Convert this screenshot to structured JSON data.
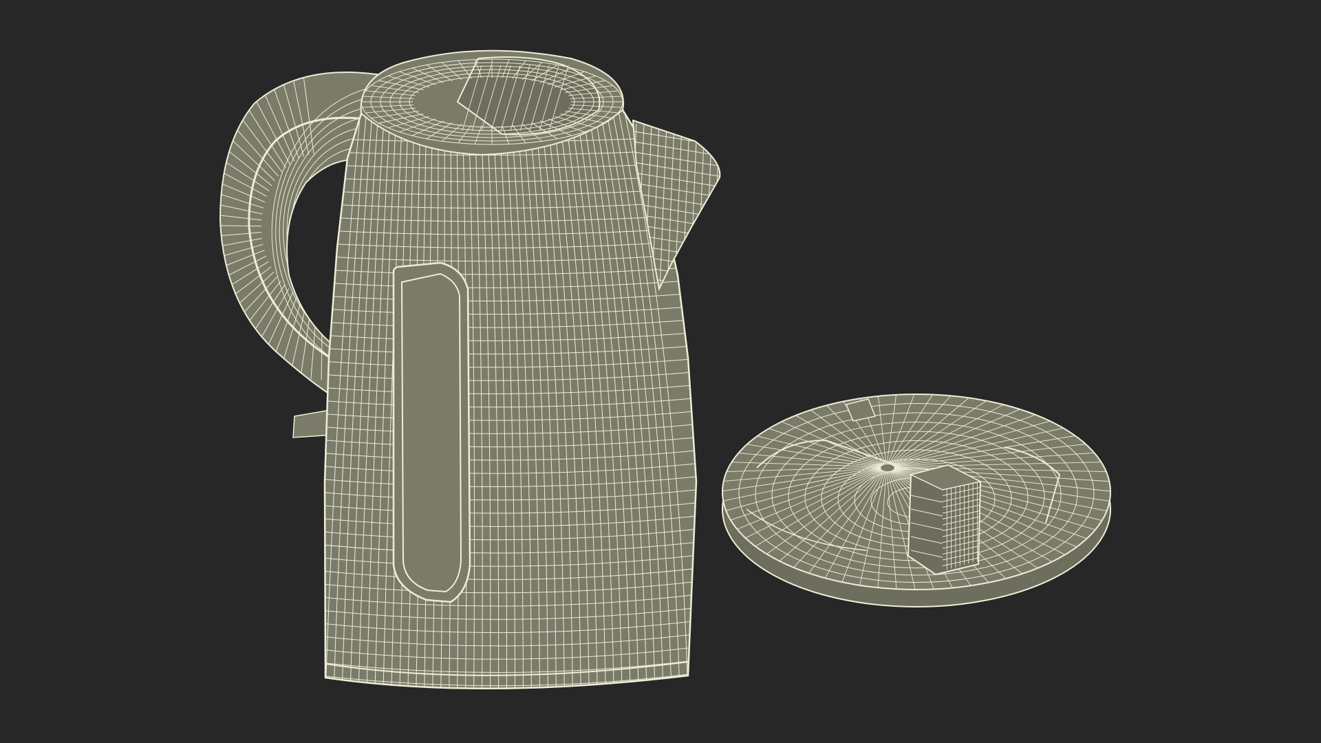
{
  "scene": {
    "background_color": "#272727",
    "mesh_fill_color": "#7b7b6a",
    "mesh_fill_shade_color": "#6e6e5e",
    "wire_color": "#eeeed8",
    "objects": [
      "kettle-body",
      "kettle-handle",
      "kettle-spout",
      "kettle-lid",
      "kettle-base-plate",
      "kettle-window-strip"
    ],
    "render_style": "wireframe-on-shaded"
  }
}
